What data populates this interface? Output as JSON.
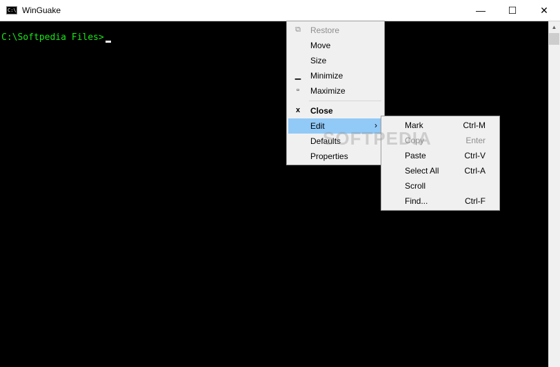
{
  "window": {
    "title": "WinGuake",
    "app_icon_text": "C:\\",
    "controls": {
      "minimize": "—",
      "maximize": "☐",
      "close": "✕"
    }
  },
  "console": {
    "prompt": "C:\\Softpedia Files>",
    "colors": {
      "prompt": "#18e818",
      "background": "#000000"
    }
  },
  "system_menu": {
    "items": [
      {
        "label": "Restore",
        "icon": "restore-icon",
        "icon_glyph": "⧉",
        "state": "disabled"
      },
      {
        "label": "Move",
        "state": "normal"
      },
      {
        "label": "Size",
        "state": "normal"
      },
      {
        "label": "Minimize",
        "icon": "minimize-icon",
        "icon_glyph": "▁",
        "state": "normal"
      },
      {
        "label": "Maximize",
        "icon": "maximize-icon",
        "icon_glyph": "▫",
        "state": "normal"
      },
      {
        "label": "Close",
        "icon": "close-icon",
        "icon_glyph": "x",
        "state": "bold"
      },
      {
        "label": "Edit",
        "submenu_arrow": "›",
        "state": "highlighted"
      },
      {
        "label": "Defaults",
        "state": "normal"
      },
      {
        "label": "Properties",
        "state": "normal"
      }
    ]
  },
  "edit_submenu": {
    "items": [
      {
        "label": "Mark",
        "shortcut": "Ctrl-M",
        "state": "normal"
      },
      {
        "label": "Copy",
        "shortcut": "Enter",
        "state": "disabled"
      },
      {
        "label": "Paste",
        "shortcut": "Ctrl-V",
        "state": "normal"
      },
      {
        "label": "Select All",
        "shortcut": "Ctrl-A",
        "state": "normal"
      },
      {
        "label": "Scroll",
        "shortcut": "",
        "state": "normal"
      },
      {
        "label": "Find...",
        "shortcut": "Ctrl-F",
        "state": "normal"
      }
    ]
  },
  "watermark": "SOFTPEDIA"
}
